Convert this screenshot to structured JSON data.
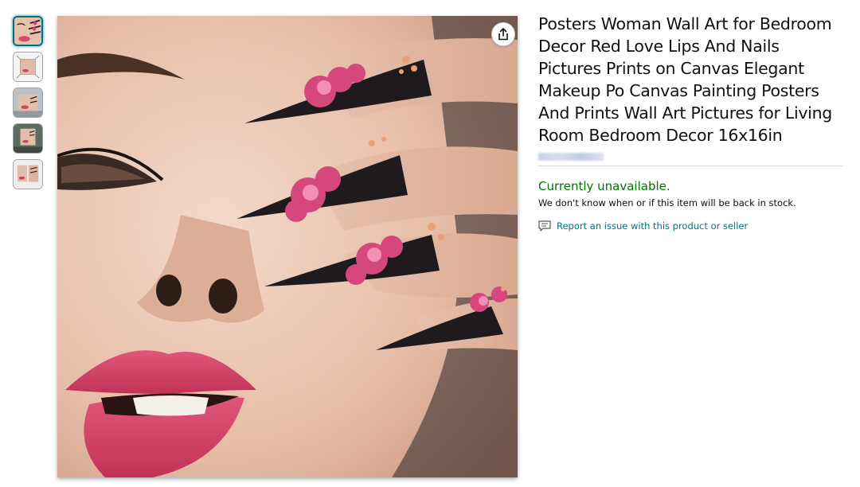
{
  "product": {
    "title": "Posters Woman Wall Art for Bedroom Decor Red Love Lips And Nails Pictures Prints on Canvas Elegant Makeup Po Canvas Painting Posters And Prints Wall Art Pictures for Living Room Bedroom Decor 16x16in"
  },
  "availability": {
    "status": "Currently unavailable.",
    "note": "We don't know when or if this item will be back in stock."
  },
  "report": {
    "label": "Report an issue with this product or seller",
    "icon": "feedback-icon"
  },
  "gallery": {
    "thumbnail_count": 5,
    "selected_index": 0
  },
  "icons": {
    "share": "share-icon"
  },
  "colors": {
    "availability": "#007600",
    "link": "#007185",
    "selected_border": "#007185"
  }
}
